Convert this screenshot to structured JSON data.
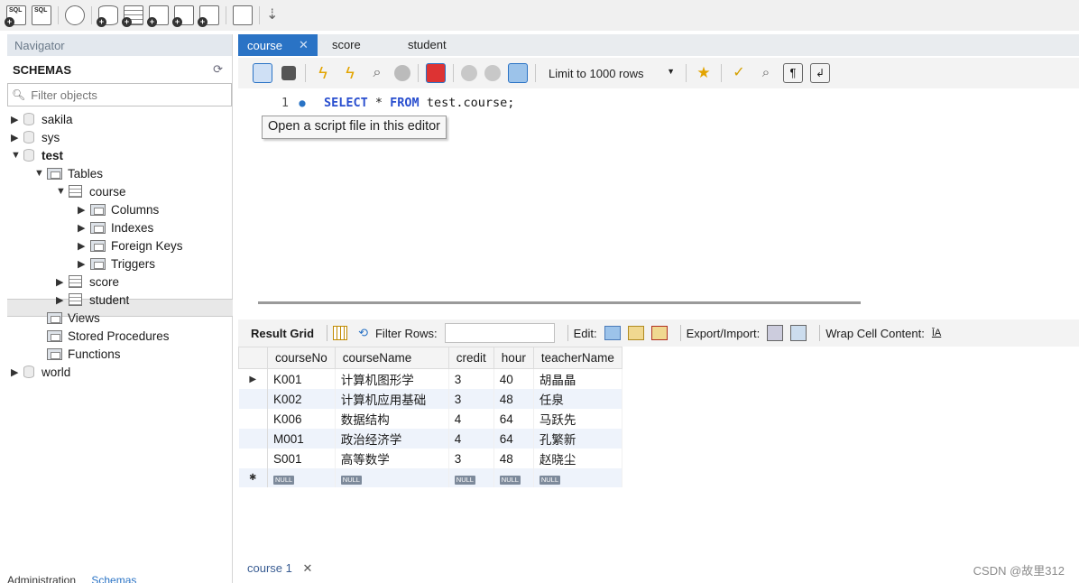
{
  "toolbar": {
    "icons": [
      "new-sql-tab-icon",
      "open-sql-file-icon",
      "inspector-icon",
      "create-schema-icon",
      "create-table-icon",
      "create-view-icon",
      "create-procedure-icon",
      "create-function-icon",
      "search-table-data-icon",
      "reconnect-icon"
    ]
  },
  "navigator": {
    "header": "Navigator",
    "schemas_title": "SCHEMAS",
    "filter_placeholder": "Filter objects",
    "schemas": {
      "sakila": "sakila",
      "sys": "sys",
      "test": "test",
      "tables": "Tables",
      "course": "course",
      "columns": "Columns",
      "indexes": "Indexes",
      "foreign_keys": "Foreign Keys",
      "triggers": "Triggers",
      "score": "score",
      "student": "student",
      "views": "Views",
      "stored_procedures": "Stored Procedures",
      "functions": "Functions",
      "world": "world"
    },
    "bottom_tabs": {
      "administration": "Administration",
      "schemas": "Schemas"
    }
  },
  "query_tabs": [
    {
      "label": "course",
      "active": true
    },
    {
      "label": "score",
      "active": false
    },
    {
      "label": "student",
      "active": false
    }
  ],
  "editor_toolbar": {
    "limit_label": "Limit to 1000 rows"
  },
  "editor": {
    "line_number": "1",
    "sql_kw1": "SELECT",
    "sql_mid": " * ",
    "sql_kw2": "FROM",
    "sql_rest": " test.course;",
    "tooltip": "Open a script file in this editor"
  },
  "result_toolbar": {
    "result_grid": "Result Grid",
    "filter_rows": "Filter Rows:",
    "edit": "Edit:",
    "export_import": "Export/Import:",
    "wrap": "Wrap Cell Content:"
  },
  "grid": {
    "columns": [
      "courseNo",
      "courseName",
      "credit",
      "hour",
      "teacherName"
    ],
    "rows": [
      [
        "K001",
        "计算机图形学",
        "3",
        "40",
        "胡晶晶"
      ],
      [
        "K002",
        "计算机应用基础",
        "3",
        "48",
        "任泉"
      ],
      [
        "K006",
        "数据结构",
        "4",
        "64",
        "马跃先"
      ],
      [
        "M001",
        "政治经济学",
        "4",
        "64",
        "孔繁新"
      ],
      [
        "S001",
        "高等数学",
        "3",
        "48",
        "赵晓尘"
      ]
    ],
    "null_label": "NULL"
  },
  "result_tab": "course 1",
  "watermark": "CSDN @故里312",
  "colors": {
    "active_tab": "#2a73c5",
    "keyword": "#2a4fcf"
  }
}
